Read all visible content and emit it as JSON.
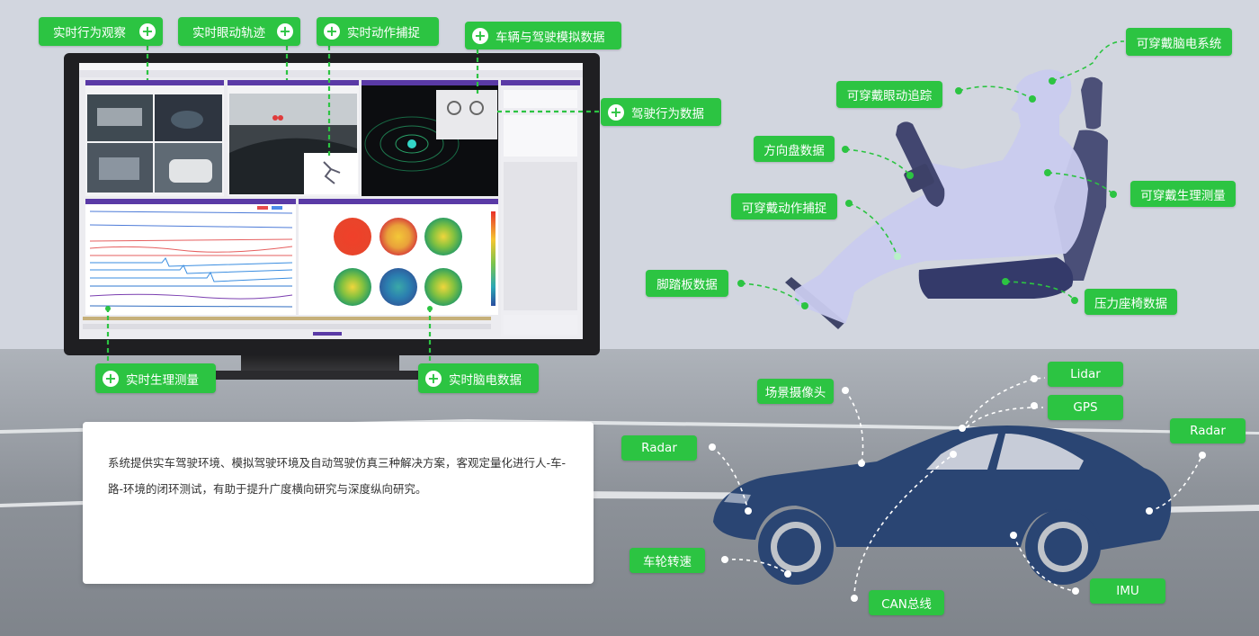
{
  "monitor_tags": {
    "behavior_observe": "实时行为观察",
    "eye_tracking": "实时眼动轨迹",
    "motion_capture": "实时动作捕捉",
    "vehicle_sim": "车辆与驾驶模拟数据",
    "driving_behavior": "驾驶行为数据",
    "physiology": "实时生理测量",
    "eeg": "实时脑电数据"
  },
  "driver_tags": {
    "wearable_eeg": "可穿戴脑电系统",
    "wearable_eye": "可穿戴眼动追踪",
    "steering": "方向盘数据",
    "wearable_physio": "可穿戴生理测量",
    "wearable_motion": "可穿戴动作捕捉",
    "pedal": "脚踏板数据",
    "pressure_seat": "压力座椅数据"
  },
  "car_tags": {
    "lidar": "Lidar",
    "gps": "GPS",
    "scene_camera": "场景摄像头",
    "radar_front": "Radar",
    "radar_rear": "Radar",
    "wheel_speed": "车轮转速",
    "can_bus": "CAN总线",
    "imu": "IMU"
  },
  "description": "系统提供实车驾驶环境、模拟驾驶环境及自动驾驶仿真三种解决方案，客观定量化进行人-车-路-环境的闭环测试，有助于提升广度横向研究与深度纵向研究。",
  "colors": {
    "tag_green": "#2cc442",
    "car_navy": "#2a4573",
    "seat_navy": "#343a6a",
    "driver_lavender": "#c7c9ee",
    "road_gray": "#8a8f97"
  },
  "icons": {
    "plus": "plus-icon"
  }
}
